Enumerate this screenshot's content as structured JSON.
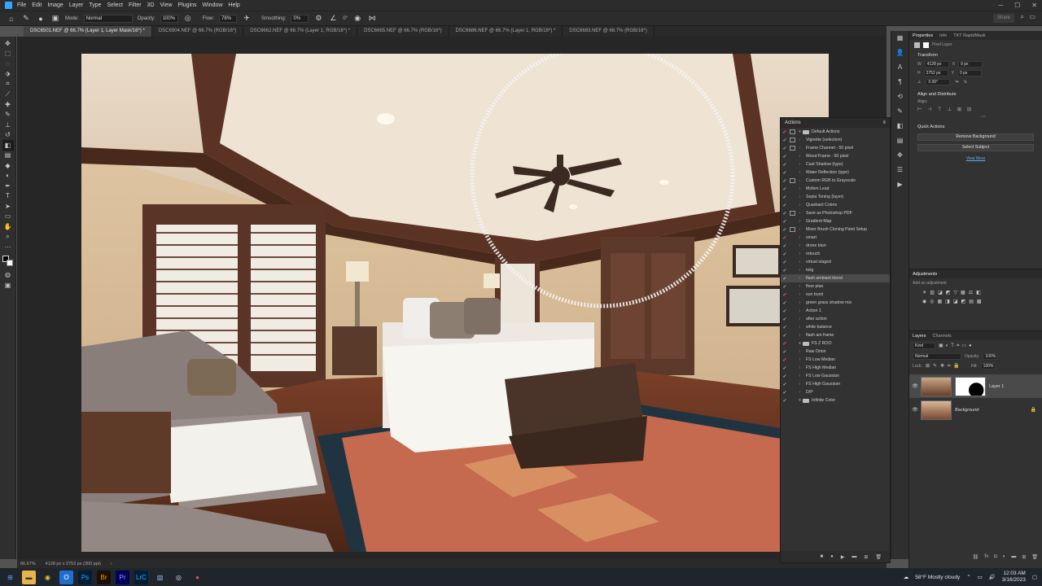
{
  "menubar": {
    "items": [
      "File",
      "Edit",
      "Image",
      "Layer",
      "Type",
      "Select",
      "Filter",
      "3D",
      "View",
      "Plugins",
      "Window",
      "Help"
    ]
  },
  "options": {
    "mode_label": "Mode:",
    "mode_value": "Normal",
    "opacity_label": "Opacity:",
    "opacity_value": "100%",
    "flow_label": "Flow:",
    "flow_value": "78%",
    "smoothing_label": "Smoothing:",
    "smoothing_value": "0%",
    "angle_value": "0°",
    "share_label": "Share"
  },
  "tabs": [
    "DSC6501.NEF @ 66.7% (Layer 1, Layer Mask/16*) *",
    "DSC6504.NEF @ 66.7% (RGB/16*)",
    "DSC6662.NEF @ 66.7% (Layer 1, RGB/16*) *",
    "DSC6665.NEF @ 66.7% (RGB/16*)",
    "DSC6686.NEF @ 66.7% (Layer 1, RGB/16*) *",
    "DSC6683.NEF @ 66.7% (RGB/16*)"
  ],
  "status": {
    "zoom": "66.67%",
    "doc_info": "4128 px x 2752 px (300 ppi)"
  },
  "actions_panel": {
    "title": "Actions",
    "items": [
      {
        "label": "Default Actions",
        "folder": true,
        "dialog": true,
        "red": true
      },
      {
        "label": "Vignette (selection)",
        "dialog": true
      },
      {
        "label": "Frame Channel - 50 pixel",
        "dialog": true
      },
      {
        "label": "Wood Frame - 50 pixel"
      },
      {
        "label": "Cast Shadow (type)"
      },
      {
        "label": "Water Reflection (type)"
      },
      {
        "label": "Custom RGB to Grayscale",
        "dialog": true
      },
      {
        "label": "Molten Lead"
      },
      {
        "label": "Sepia Toning (layer)"
      },
      {
        "label": "Quadrant Colors"
      },
      {
        "label": "Save as Photoshop PDF",
        "dialog": true
      },
      {
        "label": "Gradient Map"
      },
      {
        "label": "Mixer Brush Cloning Paint Setup",
        "dialog": true
      },
      {
        "label": "smart",
        "red": true
      },
      {
        "label": "drone blurr"
      },
      {
        "label": "retouch"
      },
      {
        "label": "virtual staged"
      },
      {
        "label": "twig"
      },
      {
        "label": "flash ambiant blend",
        "highlight": true
      },
      {
        "label": "floor plan"
      },
      {
        "label": "sun burst",
        "red": true
      },
      {
        "label": "green grass shadow mix"
      },
      {
        "label": "Action 1"
      },
      {
        "label": "after action"
      },
      {
        "label": "white balance"
      },
      {
        "label": "flash am frame"
      },
      {
        "label": "FS Z ROO",
        "folder": true,
        "red": true
      },
      {
        "label": "Raw Orion"
      },
      {
        "label": "FS Low Median",
        "red": true
      },
      {
        "label": "FS High Median"
      },
      {
        "label": "FS Low Gaussian"
      },
      {
        "label": "FS High Gaussian"
      },
      {
        "label": "D/P"
      },
      {
        "label": "Infinite Color",
        "folder": true
      }
    ]
  },
  "properties": {
    "tabs": [
      "Properties",
      "Info",
      "TKT RapidMask"
    ],
    "layer_type": "Pixel Layer",
    "transform_title": "Transform",
    "w_label": "W",
    "w_value": "4128 px",
    "h_label": "H",
    "h_value": "2752 px",
    "x_label": "X",
    "x_value": "0 px",
    "y_label": "Y",
    "y_value": "0 px",
    "angle_value": "0.00°",
    "align_title": "Align and Distribute",
    "align_label": "Align:",
    "quick_title": "Quick Actions",
    "remove_bg": "Remove Background",
    "select_subject": "Select Subject",
    "view_more": "View More"
  },
  "adjustments": {
    "title": "Adjustments",
    "add_label": "Add an adjustment"
  },
  "layers": {
    "tabs": [
      "Layers",
      "Channels"
    ],
    "kind_label": "Kind",
    "blend_value": "Normal",
    "opacity_label": "Opacity:",
    "opacity_value": "100%",
    "lock_label": "Lock:",
    "fill_label": "Fill:",
    "fill_value": "100%",
    "items": [
      {
        "name": "Layer 1",
        "selected": true,
        "has_mask": true
      },
      {
        "name": "Background",
        "selected": false,
        "locked": true
      }
    ]
  },
  "taskbar": {
    "weather": "58°F  Mostly cloudy",
    "time": "12:03 AM",
    "date": "3/16/2023",
    "apps": [
      "start",
      "explorer",
      "chrome",
      "outlook",
      "photoshop",
      "bridge",
      "premiere",
      "lightroom-classic",
      "photo-viewer",
      "obs",
      "other"
    ]
  },
  "colors": {
    "accent": "#31a8ff",
    "ui_dark": "#2c2c2c",
    "panel": "#323232"
  }
}
